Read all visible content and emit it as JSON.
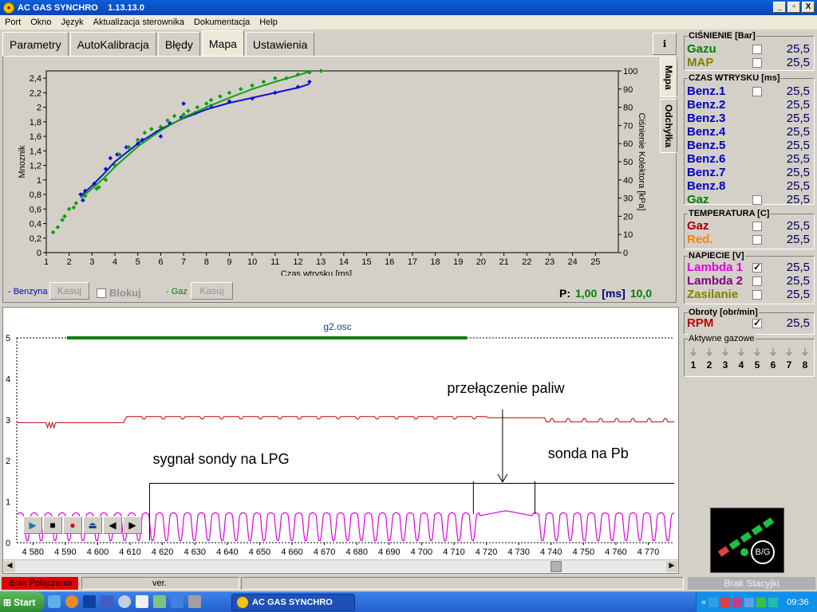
{
  "window": {
    "title": "AC GAS SYNCHRO    1.13.13.0",
    "controls": [
      "_",
      "▫",
      "X"
    ]
  },
  "menu": [
    "Port",
    "Okno",
    "Język",
    "Aktualizacja sterownika",
    "Dokumentacja",
    "Help"
  ],
  "tabs": [
    "Parametry",
    "AutoKalibracja",
    "Błędy",
    "Mapa",
    "Ustawienia"
  ],
  "active_tab": "Mapa",
  "side_tabs": [
    "Mapa",
    "Odchyłka"
  ],
  "map": {
    "benzyna_legend": "- Benzyna",
    "gaz_legend": "- Gaz",
    "kasuj_label": "Kasuj",
    "blokuj_label": "Blokuj",
    "p_label": "P:",
    "p_value": "1,00",
    "p_unit": "[ms]",
    "p_extra": "10,0"
  },
  "right_panel": {
    "cisnienie": {
      "title": "CIŚNIENIE [Bar]",
      "rows": [
        {
          "label": "Gazu",
          "value": "25,5",
          "color": "#008000",
          "checkbox": true,
          "checked": false
        },
        {
          "label": "MAP",
          "value": "25,5",
          "color": "#808000",
          "checkbox": true,
          "checked": false
        }
      ]
    },
    "czas": {
      "title": "CZAS WTRYSKU  [ms]",
      "rows": [
        {
          "label": "Benz.1",
          "value": "25,5",
          "color": "#0000c0",
          "checkbox": true,
          "checked": false
        },
        {
          "label": "Benz.2",
          "value": "25,5",
          "color": "#0000c0",
          "checkbox": false
        },
        {
          "label": "Benz.3",
          "value": "25,5",
          "color": "#0000c0",
          "checkbox": false
        },
        {
          "label": "Benz.4",
          "value": "25,5",
          "color": "#0000c0",
          "checkbox": false
        },
        {
          "label": "Benz.5",
          "value": "25,5",
          "color": "#0000c0",
          "checkbox": false
        },
        {
          "label": "Benz.6",
          "value": "25,5",
          "color": "#0000c0",
          "checkbox": false
        },
        {
          "label": "Benz.7",
          "value": "25,5",
          "color": "#0000c0",
          "checkbox": false
        },
        {
          "label": "Benz.8",
          "value": "25,5",
          "color": "#0000c0",
          "checkbox": false
        },
        {
          "label": "Gaz",
          "value": "25,5",
          "color": "#008000",
          "checkbox": true,
          "checked": false
        }
      ]
    },
    "temperatura": {
      "title": "TEMPERATURA  [C]",
      "rows": [
        {
          "label": "Gaz",
          "value": "25,5",
          "color": "#a00000",
          "checkbox": true,
          "checked": false
        },
        {
          "label": "Red.",
          "value": "25,5",
          "color": "#ff8000",
          "checkbox": true,
          "checked": false
        }
      ]
    },
    "napiecie": {
      "title": "NAPIECIE [V]",
      "rows": [
        {
          "label": "Lambda 1",
          "value": "25,5",
          "color": "#e000e0",
          "checkbox": true,
          "checked": true
        },
        {
          "label": "Lambda 2",
          "value": "25,5",
          "color": "#800080",
          "checkbox": true,
          "checked": false
        },
        {
          "label": "Zasilanie",
          "value": "25,5",
          "color": "#808000",
          "checkbox": true,
          "checked": false
        }
      ]
    },
    "obroty": {
      "title": "Obroty [obr/min]",
      "rows": [
        {
          "label": "RPM",
          "value": "25,5",
          "color": "#c00000",
          "checkbox": true,
          "checked": true
        }
      ]
    },
    "aktywne": {
      "title": "Aktywne gazowe",
      "numbers": [
        "1",
        "2",
        "3",
        "4",
        "5",
        "6",
        "7",
        "8"
      ]
    },
    "bg_label": "B/G"
  },
  "oscilloscope": {
    "title": "g2.osc",
    "y_ticks": [
      "0",
      "1",
      "2",
      "3",
      "4",
      "5"
    ],
    "x_ticks": [
      "4 580",
      "4 590",
      "4 600",
      "4 610",
      "4 620",
      "4 630",
      "4 640",
      "4 650",
      "4 660",
      "4 670",
      "4 680",
      "4 690",
      "4 700",
      "4 710",
      "4 720",
      "4 730",
      "4 740",
      "4 750",
      "4 760",
      "4 770"
    ],
    "annotations": {
      "switch": "przełączenie paliw",
      "lpg": "sygnał sondy na LPG",
      "pb": "sonda na Pb"
    }
  },
  "status": {
    "connection": "Brak Połączenia",
    "ver": "ver.",
    "station": "Brak Stacyjki"
  },
  "taskbar": {
    "start": "Start",
    "task": "AC GAS SYNCHRO",
    "clock": "09:36"
  },
  "chart_data": [
    {
      "type": "scatter",
      "xlabel": "Czas wtrysku [ms]",
      "ylabel": "Mnoznik",
      "y2label": "Ciśnienie Kolektora [kPa]",
      "xlim": [
        1,
        26
      ],
      "ylim": [
        0,
        2.5
      ],
      "y2lim": [
        0,
        100
      ],
      "x_ticks": [
        "1",
        "2",
        "3",
        "4",
        "5",
        "6",
        "7",
        "8",
        "9",
        "10",
        "11",
        "12",
        "13",
        "14",
        "15",
        "16",
        "17",
        "18",
        "19",
        "20",
        "21",
        "22",
        "23",
        "24",
        "25"
      ],
      "y_ticks": [
        "0",
        "0,2",
        "0,4",
        "0,6",
        "0,8",
        "1",
        "1,2",
        "1,4",
        "1,6",
        "1,8",
        "2",
        "2,2",
        "2,4"
      ],
      "y2_ticks": [
        "0",
        "10",
        "20",
        "30",
        "40",
        "50",
        "60",
        "70",
        "80",
        "90",
        "100"
      ],
      "series": [
        {
          "name": "Benzyna",
          "color": "#1010d0",
          "curve": [
            [
              2.5,
              0.78
            ],
            [
              3,
              0.92
            ],
            [
              3.5,
              1.08
            ],
            [
              4,
              1.25
            ],
            [
              5,
              1.5
            ],
            [
              6,
              1.7
            ],
            [
              7,
              1.85
            ],
            [
              8,
              1.97
            ],
            [
              9,
              2.06
            ],
            [
              10,
              2.13
            ],
            [
              11,
              2.2
            ],
            [
              12,
              2.27
            ],
            [
              12.5,
              2.32
            ]
          ],
          "points": [
            [
              2.5,
              0.8
            ],
            [
              2.7,
              0.85
            ],
            [
              2.6,
              0.72
            ],
            [
              3.1,
              0.95
            ],
            [
              3.6,
              1.15
            ],
            [
              3.8,
              1.3
            ],
            [
              4.1,
              1.35
            ],
            [
              4.5,
              1.45
            ],
            [
              5,
              1.5
            ],
            [
              5.2,
              1.55
            ],
            [
              5.8,
              1.65
            ],
            [
              6,
              1.6
            ],
            [
              6.4,
              1.78
            ],
            [
              6.9,
              1.86
            ],
            [
              7,
              2.05
            ],
            [
              7.5,
              1.92
            ],
            [
              8.2,
              2.02
            ],
            [
              9,
              2.08
            ],
            [
              10,
              2.12
            ],
            [
              11,
              2.2
            ],
            [
              12,
              2.28
            ],
            [
              12.5,
              2.35
            ]
          ]
        },
        {
          "name": "Gaz",
          "color": "#10a010",
          "curve": [
            [
              2.5,
              0.75
            ],
            [
              3,
              0.88
            ],
            [
              3.5,
              1.02
            ],
            [
              4,
              1.18
            ],
            [
              5,
              1.46
            ],
            [
              6,
              1.68
            ],
            [
              7,
              1.86
            ],
            [
              8,
              2.0
            ],
            [
              9,
              2.13
            ],
            [
              10,
              2.25
            ],
            [
              11,
              2.35
            ],
            [
              12,
              2.44
            ],
            [
              12.6,
              2.5
            ]
          ],
          "points": [
            [
              1.3,
              0.28
            ],
            [
              1.5,
              0.35
            ],
            [
              1.7,
              0.45
            ],
            [
              1.8,
              0.5
            ],
            [
              2,
              0.6
            ],
            [
              2.2,
              0.62
            ],
            [
              2.3,
              0.68
            ],
            [
              2.7,
              0.78
            ],
            [
              3.2,
              0.88
            ],
            [
              3.3,
              0.9
            ],
            [
              3.6,
              1.0
            ],
            [
              4,
              1.2
            ],
            [
              4.2,
              1.35
            ],
            [
              4.6,
              1.45
            ],
            [
              5,
              1.55
            ],
            [
              5.3,
              1.65
            ],
            [
              5.6,
              1.7
            ],
            [
              6,
              1.73
            ],
            [
              6.3,
              1.82
            ],
            [
              6.6,
              1.88
            ],
            [
              7,
              1.9
            ],
            [
              7.2,
              1.95
            ],
            [
              7.6,
              2.0
            ],
            [
              8,
              2.05
            ],
            [
              8.2,
              2.1
            ],
            [
              8.6,
              2.15
            ],
            [
              9,
              2.2
            ],
            [
              9.5,
              2.25
            ],
            [
              10,
              2.3
            ],
            [
              10.5,
              2.35
            ],
            [
              11,
              2.4
            ],
            [
              11.5,
              2.4
            ],
            [
              12,
              2.45
            ],
            [
              12.5,
              2.48
            ],
            [
              13,
              2.5
            ]
          ]
        }
      ]
    },
    {
      "type": "line",
      "title": "g2.osc",
      "xlim": [
        4575,
        4778
      ],
      "ylim": [
        0,
        5
      ],
      "series": [
        {
          "name": "Lambda 1",
          "color": "#e000e0"
        },
        {
          "name": "RPM",
          "color": "#c00000"
        }
      ]
    }
  ]
}
